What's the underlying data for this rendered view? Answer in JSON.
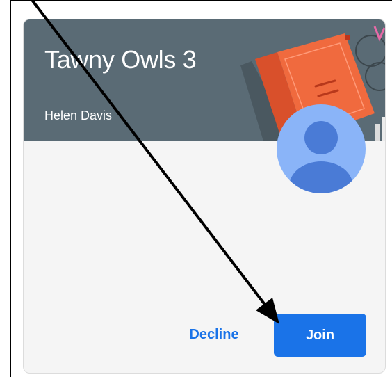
{
  "card": {
    "class_name": "Tawny Owls 3",
    "teacher_name": "Helen Davis"
  },
  "actions": {
    "decline_label": "Decline",
    "join_label": "Join"
  },
  "colors": {
    "banner": "#5a6b75",
    "primary": "#1a73e8",
    "card_background": "#f5f5f5",
    "avatar_background": "#8ab4f8",
    "avatar_figure": "#4a7bd6"
  },
  "icons": {
    "avatar": "account-circle-icon",
    "banner_illustration": "book-icon",
    "annotation": "arrow-annotation-icon"
  }
}
